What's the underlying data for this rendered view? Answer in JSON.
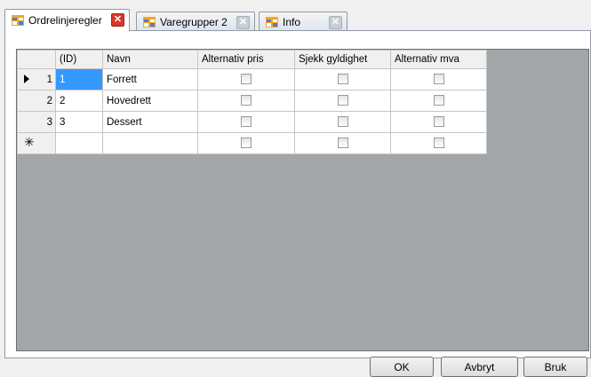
{
  "tabs": [
    {
      "label": "Ordrelinjeregler",
      "active": true,
      "icon": "table-icon"
    },
    {
      "label": "Varegrupper 2",
      "active": false,
      "icon": "table-icon"
    },
    {
      "label": "Info",
      "active": false,
      "icon": "table-icon"
    }
  ],
  "grid": {
    "columns": [
      "(ID)",
      "Navn",
      "Alternativ pris",
      "Sjekk gyldighet",
      "Alternativ mva"
    ],
    "rows": [
      {
        "rownum": "1",
        "id": "1",
        "navn": "Forrett",
        "alt_pris": false,
        "sjekk": false,
        "alt_mva": false,
        "current": true
      },
      {
        "rownum": "2",
        "id": "2",
        "navn": "Hovedrett",
        "alt_pris": false,
        "sjekk": false,
        "alt_mva": false,
        "current": false
      },
      {
        "rownum": "3",
        "id": "3",
        "navn": "Dessert",
        "alt_pris": false,
        "sjekk": false,
        "alt_mva": false,
        "current": false
      }
    ],
    "new_row_marker": "✳"
  },
  "buttons": {
    "ok": "OK",
    "cancel": "Avbryt",
    "apply": "Bruk"
  },
  "colors": {
    "selection": "#3399ff",
    "grid_background": "#a3a6a9",
    "close_active": "#d9372b"
  }
}
